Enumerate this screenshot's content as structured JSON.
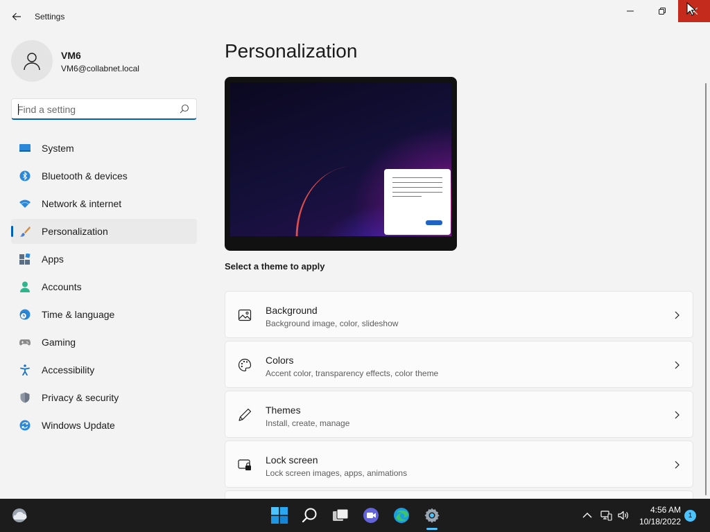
{
  "window": {
    "app_title": "Settings"
  },
  "profile": {
    "name": "VM6",
    "email": "VM6@collabnet.local"
  },
  "search": {
    "placeholder": "Find a setting",
    "value": ""
  },
  "sidebar": {
    "items": [
      {
        "label": "System",
        "icon": "system-icon",
        "active": false
      },
      {
        "label": "Bluetooth & devices",
        "icon": "bluetooth-icon",
        "active": false
      },
      {
        "label": "Network & internet",
        "icon": "wifi-icon",
        "active": false
      },
      {
        "label": "Personalization",
        "icon": "brush-icon",
        "active": true
      },
      {
        "label": "Apps",
        "icon": "apps-icon",
        "active": false
      },
      {
        "label": "Accounts",
        "icon": "accounts-icon",
        "active": false
      },
      {
        "label": "Time & language",
        "icon": "globe-clock-icon",
        "active": false
      },
      {
        "label": "Gaming",
        "icon": "gamepad-icon",
        "active": false
      },
      {
        "label": "Accessibility",
        "icon": "accessibility-icon",
        "active": false
      },
      {
        "label": "Privacy & security",
        "icon": "shield-icon",
        "active": false
      },
      {
        "label": "Windows Update",
        "icon": "update-icon",
        "active": false
      }
    ]
  },
  "main": {
    "title": "Personalization",
    "theme_label": "Select a theme to apply",
    "cards": [
      {
        "title": "Background",
        "subtitle": "Background image, color, slideshow",
        "icon": "image-icon"
      },
      {
        "title": "Colors",
        "subtitle": "Accent color, transparency effects, color theme",
        "icon": "palette-icon"
      },
      {
        "title": "Themes",
        "subtitle": "Install, create, manage",
        "icon": "pen-icon"
      },
      {
        "title": "Lock screen",
        "subtitle": "Lock screen images, apps, animations",
        "icon": "lock-screen-icon"
      }
    ]
  },
  "taskbar": {
    "time": "4:56 AM",
    "date": "10/18/2022",
    "notification_count": "1"
  },
  "colors": {
    "accent": "#005fb8",
    "close_button": "#c42b1c",
    "taskbar": "#1c1c1c"
  }
}
